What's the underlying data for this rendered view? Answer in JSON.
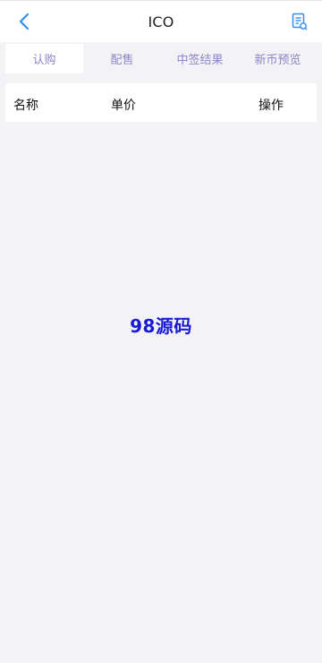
{
  "header": {
    "title": "ICO",
    "accent_color": "#2f8cf0",
    "back_icon": "chevron-left-icon",
    "record_icon": "document-list-icon"
  },
  "tabs": [
    {
      "label": "认购",
      "active": true
    },
    {
      "label": "配售",
      "active": false
    },
    {
      "label": "中签结果",
      "active": false
    },
    {
      "label": "新币预览",
      "active": false
    }
  ],
  "table": {
    "columns": [
      "名称",
      "单价",
      "操作"
    ]
  },
  "watermark": "98源码"
}
